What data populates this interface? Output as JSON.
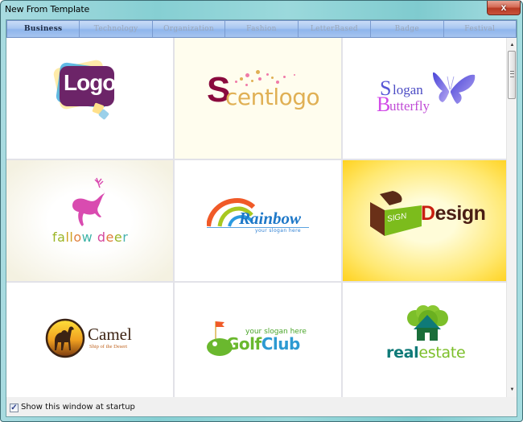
{
  "window": {
    "title": "New From Template",
    "close_label": "x"
  },
  "tabs": [
    {
      "label": "Business",
      "active": true
    },
    {
      "label": "Technology",
      "active": false
    },
    {
      "label": "Organization",
      "active": false
    },
    {
      "label": "Fashion",
      "active": false
    },
    {
      "label": "LetterBased",
      "active": false
    },
    {
      "label": "Badge",
      "active": false
    },
    {
      "label": "Festival",
      "active": false
    }
  ],
  "templates": [
    {
      "name": "Logo",
      "text": "Logo",
      "colors": {
        "primary": "#6c2468",
        "accent1": "#39a9e0",
        "accent2": "#ffe89a"
      }
    },
    {
      "name": "Scentlogo",
      "first_letter": "S",
      "rest": "centlogo",
      "colors": {
        "primary": "#8a0a3d",
        "secondary": "#e0b054",
        "dots": "#f07aa8",
        "background": "#fffdee"
      }
    },
    {
      "name": "Slogan Butterfly",
      "line1_initial": "S",
      "line1_rest": "logan",
      "line2_initial": "B",
      "line2_rest": "utterfly",
      "colors": {
        "primary": "#5856d6",
        "secondary": "#d24be8"
      }
    },
    {
      "name": "fallow deer",
      "letters": [
        {
          "ch": "f",
          "color": "#9bb525"
        },
        {
          "ch": "a",
          "color": "#9bb525"
        },
        {
          "ch": "l",
          "color": "#d0a020"
        },
        {
          "ch": "l",
          "color": "#d0a020"
        },
        {
          "ch": "o",
          "color": "#e08040"
        },
        {
          "ch": "w",
          "color": "#3fb4a8"
        },
        {
          "ch": " ",
          "color": "#000"
        },
        {
          "ch": "d",
          "color": "#d5479c"
        },
        {
          "ch": "e",
          "color": "#e07a3a"
        },
        {
          "ch": "e",
          "color": "#9bb525"
        },
        {
          "ch": "r",
          "color": "#48b3b0"
        }
      ],
      "colors": {
        "deer": "#d94bb0"
      }
    },
    {
      "name": "Rainbow",
      "text": "Rainbow",
      "slogan": "your slogan here",
      "colors": {
        "text": "#1e78c8"
      }
    },
    {
      "name": "SignDesign",
      "box_text": "SIGN",
      "word_first": "D",
      "word_rest": "esign",
      "colors": {
        "box": "#5a2b18",
        "green": "#7cbc1c",
        "text": "#4a1e14",
        "accent": "#c81e10"
      }
    },
    {
      "name": "Camel",
      "text": "Camel",
      "slogan": "Ship of the Desert",
      "colors": {
        "text": "#3c2313",
        "slogan": "#c06420"
      }
    },
    {
      "name": "GolfClub",
      "slogan": "your slogan here",
      "word1": "Golf",
      "word2": "Club",
      "colors": {
        "green": "#6ab82e",
        "blue": "#2d9ad2",
        "flag": "#f05a28"
      }
    },
    {
      "name": "realestate",
      "word1": "real",
      "word2": "estate",
      "colors": {
        "dark": "#0f7a78",
        "light": "#7cbf2a",
        "house": "#1a6e3a"
      }
    }
  ],
  "footer": {
    "show_at_startup_label": "Show this window at startup",
    "show_at_startup_checked": true,
    "check_glyph": "✓"
  },
  "scrollbar": {
    "up_glyph": "▲",
    "down_glyph": "▼"
  }
}
